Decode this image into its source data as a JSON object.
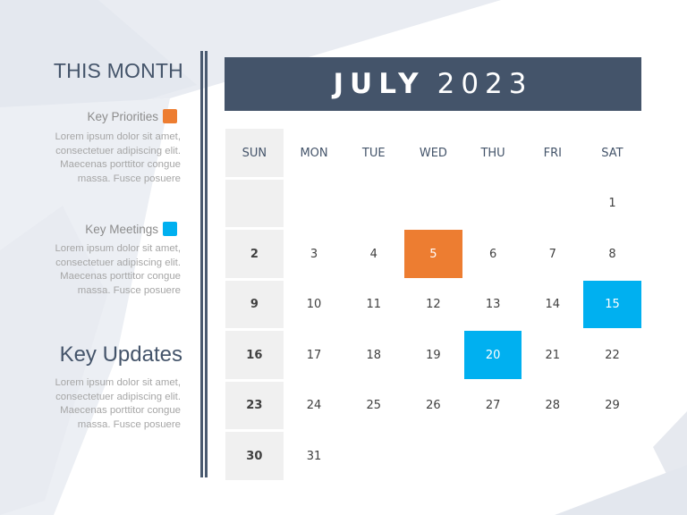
{
  "colors": {
    "header_bg": "#44546a",
    "title_text": "#44546a",
    "priority": "#ed7d31",
    "meeting": "#00b0f0",
    "sunday_bg": "#f0f0f0",
    "body_text": "#a6a6a6"
  },
  "sidebar": {
    "title": "THIS MONTH",
    "legend": [
      {
        "label": "Key Priorities",
        "color": "#ed7d31",
        "text": [
          "Lorem ipsum dolor sit amet,",
          "consectetuer adipiscing elit.",
          "Maecenas porttitor congue",
          "massa. Fusce posuere"
        ]
      },
      {
        "label": "Key Meetings",
        "color": "#00b0f0",
        "text": [
          "Lorem ipsum dolor sit amet,",
          "consectetuer adipiscing elit.",
          "Maecenas porttitor congue",
          "massa. Fusce posuere"
        ]
      }
    ],
    "updates": {
      "title": "Key Updates",
      "text": [
        "Lorem ipsum dolor sit amet,",
        "consectetuer adipiscing elit.",
        "Maecenas porttitor congue",
        "massa. Fusce posuere"
      ]
    }
  },
  "calendar": {
    "month": "JULY",
    "year": "2023",
    "weekdays": [
      "SUN",
      "MON",
      "TUE",
      "WED",
      "THU",
      "FRI",
      "SAT"
    ],
    "weeks": [
      [
        "",
        "",
        "",
        "",
        "",
        "",
        "1"
      ],
      [
        "2",
        "3",
        "4",
        "5",
        "6",
        "7",
        "8"
      ],
      [
        "9",
        "10",
        "11",
        "12",
        "13",
        "14",
        "15"
      ],
      [
        "16",
        "17",
        "18",
        "19",
        "20",
        "21",
        "22"
      ],
      [
        "23",
        "24",
        "25",
        "26",
        "27",
        "28",
        "29"
      ],
      [
        "30",
        "31",
        "",
        "",
        "",
        "",
        ""
      ]
    ],
    "highlights": {
      "5": "priority",
      "15": "meeting",
      "20": "meeting"
    }
  }
}
